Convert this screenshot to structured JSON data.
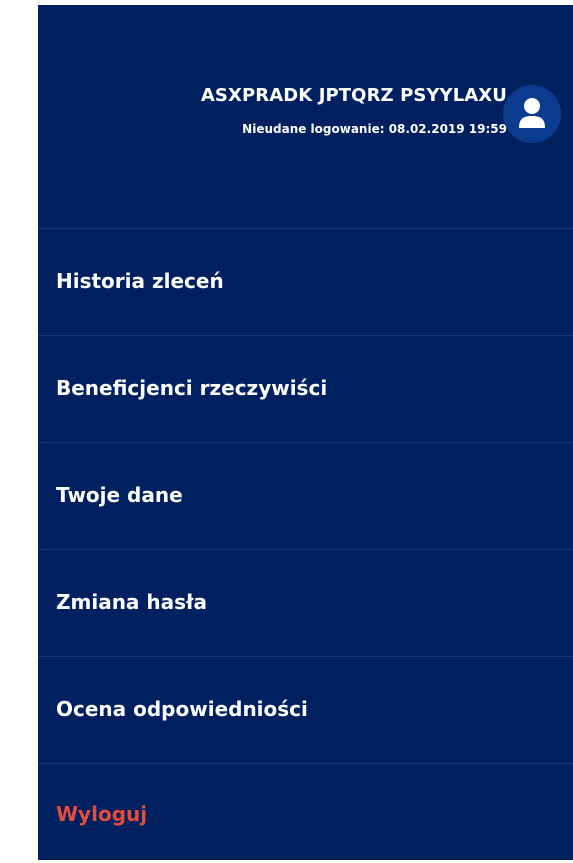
{
  "user": {
    "name": "ASXPRADK JPTQRZ PSYYLAXU",
    "last_login": "Nieudane logowanie: 08.02.2019 19:59",
    "avatar_icon": "user-icon"
  },
  "menu": {
    "items": [
      {
        "label": "Historia zleceń"
      },
      {
        "label": "Beneficjenci rzeczywiści"
      },
      {
        "label": "Twoje dane"
      },
      {
        "label": "Zmiana hasła"
      },
      {
        "label": "Ocena odpowiedniości"
      },
      {
        "label": "Wyloguj"
      }
    ]
  },
  "colors": {
    "panel_background": "#002060",
    "divider": "#143674",
    "text": "#ffffff",
    "logout": "#e44d3a",
    "avatar_background": "#0a3b8c"
  }
}
